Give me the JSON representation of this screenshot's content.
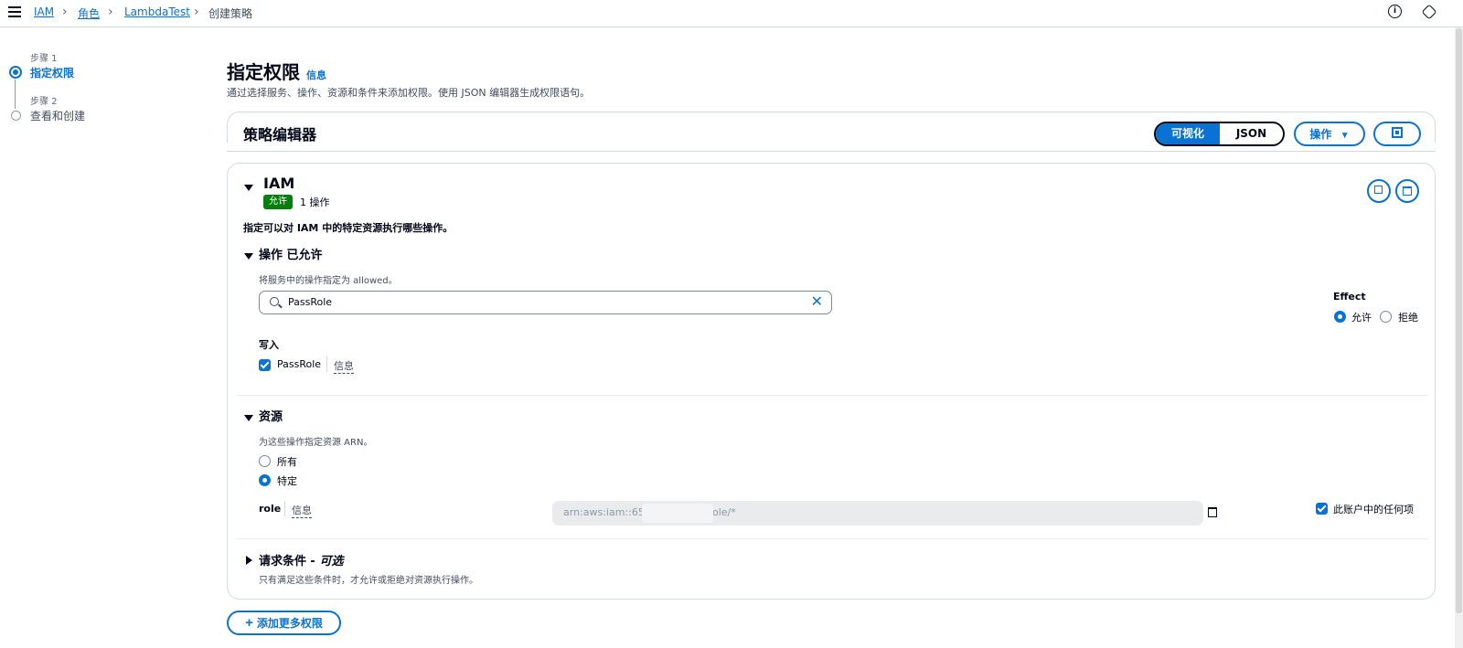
{
  "breadcrumb": {
    "items": [
      "IAM",
      "角色",
      "LambdaTest"
    ],
    "current": "创建策略"
  },
  "steps": [
    {
      "label": "步骤 1",
      "title": "指定权限"
    },
    {
      "label": "步骤 2",
      "title": "查看和创建"
    }
  ],
  "header": {
    "title": "指定权限",
    "info": "信息",
    "description": "通过选择服务、操作、资源和条件来添加权限。使用 JSON 编辑器生成权限语句。"
  },
  "editor": {
    "title": "策略编辑器",
    "toggle": {
      "visual": "可视化",
      "json": "JSON"
    },
    "actions_label": "操作"
  },
  "service": {
    "name": "IAM",
    "badge": "允许",
    "action_count": "1 操作",
    "description": "指定可以对 IAM 中的特定资源执行哪些操作。"
  },
  "actions_section": {
    "title": "操作 已允许",
    "hint": "将服务中的操作指定为 allowed。",
    "search_value": "PassRole",
    "effect_label": "Effect",
    "effect_allow": "允许",
    "effect_deny": "拒绝",
    "group": "写入",
    "action_name": "PassRole",
    "action_info": "信息"
  },
  "resources": {
    "title": "资源",
    "hint": "为这些操作指定资源 ARN。",
    "option_all": "所有",
    "option_specific": "特定",
    "role_label": "role",
    "role_info": "信息",
    "arn_prefix": "arn:aws:iam::65",
    "arn_suffix": "ole/*",
    "any_account": "此账户中的任何项"
  },
  "conditions": {
    "title": "请求条件",
    "optional": " - 可选",
    "hint": "只有满足这些条件时，才允许或拒绝对资源执行操作。"
  },
  "add_more": "添加更多权限",
  "colors": {
    "primary": "#0972d3",
    "allow_badge": "#037f0c",
    "border": "#d5dbdb"
  }
}
